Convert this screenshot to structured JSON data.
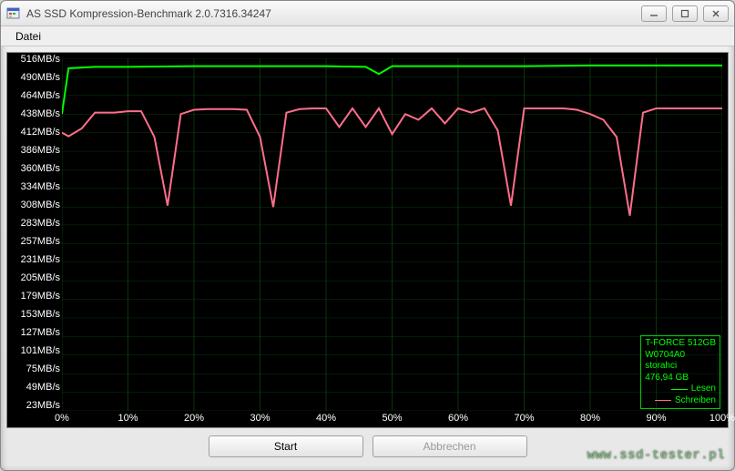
{
  "window": {
    "title": "AS SSD Kompression-Benchmark 2.0.7316.34247"
  },
  "menu": {
    "file": "Datei"
  },
  "buttons": {
    "start": "Start",
    "abort": "Abbrechen"
  },
  "watermark": "www.ssd-tester.pl",
  "legend": {
    "device": "T-FORCE 512GB",
    "firmware": "W0704A0",
    "driver": "storahci",
    "capacity": "476,94 GB",
    "read": "Lesen",
    "write": "Schreiben",
    "read_color": "#00ff00",
    "write_color": "#ff6e8a"
  },
  "chart_data": {
    "type": "line",
    "xlabel": "",
    "ylabel": "",
    "x_unit": "%",
    "y_unit": "MB/s",
    "xlim": [
      0,
      100
    ],
    "ylim": [
      23,
      516
    ],
    "y_ticks": [
      516,
      490,
      464,
      438,
      412,
      386,
      360,
      334,
      308,
      283,
      257,
      231,
      205,
      179,
      153,
      127,
      101,
      75,
      49,
      23
    ],
    "y_tick_labels": [
      "516MB/s",
      "490MB/s",
      "464MB/s",
      "438MB/s",
      "412MB/s",
      "386MB/s",
      "360MB/s",
      "334MB/s",
      "308MB/s",
      "283MB/s",
      "257MB/s",
      "231MB/s",
      "205MB/s",
      "179MB/s",
      "153MB/s",
      "127MB/s",
      "101MB/s",
      "75MB/s",
      "49MB/s",
      "23MB/s"
    ],
    "x_ticks": [
      0,
      10,
      20,
      30,
      40,
      50,
      60,
      70,
      80,
      90,
      100
    ],
    "x_tick_labels": [
      "0%",
      "10%",
      "20%",
      "30%",
      "40%",
      "50%",
      "60%",
      "70%",
      "80%",
      "90%",
      "100%"
    ],
    "series": [
      {
        "name": "Lesen",
        "color": "#00ff00",
        "x": [
          0,
          1,
          5,
          10,
          20,
          30,
          40,
          46,
          48,
          50,
          60,
          70,
          80,
          90,
          100
        ],
        "y": [
          438,
          502,
          504,
          504,
          505,
          505,
          505,
          504,
          494,
          505,
          505,
          505,
          506,
          506,
          506
        ]
      },
      {
        "name": "Schreiben",
        "color": "#ff6e8a",
        "x": [
          0,
          1,
          3,
          5,
          8,
          10,
          12,
          14,
          16,
          18,
          20,
          22,
          26,
          28,
          30,
          32,
          34,
          36,
          38,
          40,
          42,
          44,
          46,
          48,
          50,
          52,
          54,
          56,
          58,
          60,
          62,
          64,
          66,
          68,
          70,
          72,
          76,
          78,
          80,
          82,
          84,
          86,
          88,
          90,
          92,
          96,
          100
        ],
        "y": [
          412,
          407,
          418,
          440,
          440,
          442,
          442,
          406,
          310,
          438,
          444,
          445,
          445,
          444,
          406,
          308,
          440,
          445,
          446,
          446,
          420,
          446,
          420,
          446,
          410,
          438,
          430,
          446,
          425,
          446,
          440,
          446,
          415,
          310,
          446,
          446,
          446,
          444,
          438,
          430,
          406,
          296,
          440,
          446,
          446,
          446,
          446
        ]
      }
    ]
  }
}
